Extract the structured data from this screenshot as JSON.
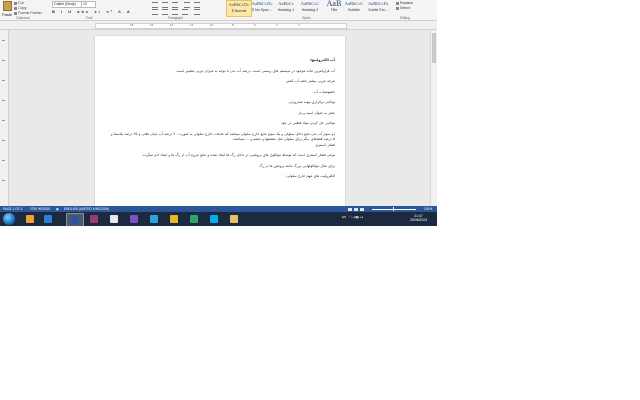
{
  "ribbon": {
    "clipboard": {
      "paste_label": "Paste",
      "cut_label": "Cut",
      "copy_label": "Copy",
      "format_painter_label": "Format Painter"
    },
    "font": {
      "name": "Calibri (Body)",
      "size": "12",
      "format_buttons": [
        "B",
        "I",
        "U",
        "abc",
        "x₂",
        "x²",
        "A",
        "A"
      ]
    },
    "styles": [
      {
        "preview": "AaBbCcDc",
        "label": "¶ Normal",
        "selected": true
      },
      {
        "preview": "AaBbCcDc",
        "label": "¶ No Spac..."
      },
      {
        "preview": "AaBbCc",
        "label": "Heading 1"
      },
      {
        "preview": "AaBbCcC",
        "label": "Heading 2"
      },
      {
        "preview": "AaB",
        "label": "Title"
      },
      {
        "preview": "AaBbCcC",
        "label": "Subtitle"
      },
      {
        "preview": "AaBbCcDı",
        "label": "Subtle Em..."
      }
    ],
    "editing": {
      "replace_label": "Replace",
      "select_label": "Select"
    },
    "group_labels": {
      "clipboard": "Clipboard",
      "font": "Font",
      "paragraph": "Paragraph",
      "styles": "Styles",
      "editing": "Editing"
    }
  },
  "ruler": {
    "numbers": [
      "18",
      "16",
      "14",
      "12",
      "10",
      "8",
      "6",
      "4",
      "2"
    ]
  },
  "document": {
    "paragraphs": [
      "آب الکترولیتها",
      "آب فراوانترین ماده موجود در سیستم های زیستی است. درصد آب بدن با توجه به میزان چربی متغییر است.",
      "هرچه چربی بیشتر باشد آب کمتر.",
      "خصوصیات آب",
      "توانایی برقراری پیوند هیدروژنی",
      "عمل به عنوان اسید و باز",
      "توانایی حل کردن مواد قطبی در خود",
      "دو سوم آب بدن مایع داخل سلولی و یک سوم مایع خارج سلولی میباشد که مایعات خارج سلولی به صورت ۲۰ درصد آب میان بافتی و ۲۵ درصد پلاسما و ۵ درصد فضاهای دیگر برای سلولی مثل مفصلها و چشم و ... میباشند.",
      "فشار اسمزی",
      "نوعی فشار اسمزی است که توسط مولکول های پروتئینی در داخل رگ ها ایجاد شده و مانع خروج آب از رگ ها و ایجاد ادم میگردد.",
      "برای مثال مولکولهایی بزرگ مانند پروتئین ها در رگ",
      "الکترولیت های مهم خارج سلولی:"
    ]
  },
  "status": {
    "page": "PAGE 1 OF 3",
    "words": "2790 WORDS",
    "language": "ENGLISH (UNITED KINGDOM)",
    "zoom": "100%"
  },
  "taskbar": {
    "apps": [
      {
        "name": "media-player",
        "color": "#f0a22e"
      },
      {
        "name": "internet-explorer",
        "color": "#2f7fd6"
      },
      {
        "name": "word",
        "color": "#2b579a",
        "active": true
      },
      {
        "name": "winrar",
        "color": "#9b3c6e"
      },
      {
        "name": "paint",
        "color": "#e8e8e8"
      },
      {
        "name": "viber",
        "color": "#7b51c7"
      },
      {
        "name": "telegram",
        "color": "#2aa3df"
      },
      {
        "name": "chrome",
        "color": "#e9b826"
      },
      {
        "name": "network-app",
        "color": "#2fa36b"
      },
      {
        "name": "skype",
        "color": "#00aff0"
      },
      {
        "name": "explorer",
        "color": "#e6c163"
      }
    ],
    "tray_lang": "EN",
    "time": "21:47",
    "date": "25/06/2024"
  }
}
